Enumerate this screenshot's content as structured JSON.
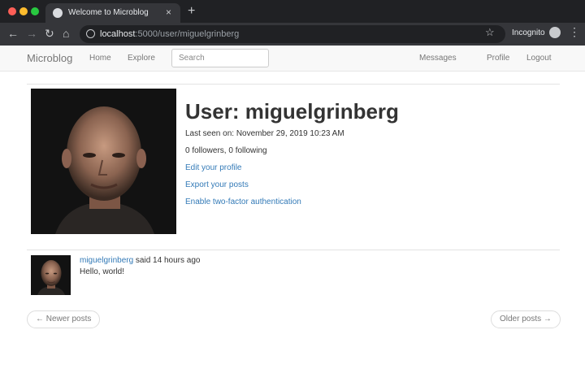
{
  "browser": {
    "tab_title": "Welcome to Microblog",
    "url_host": "localhost",
    "url_path": ":5000/user/miguelgrinberg",
    "profile_label": "Incognito"
  },
  "navbar": {
    "brand": "Microblog",
    "home": "Home",
    "explore": "Explore",
    "search_placeholder": "Search",
    "messages": "Messages",
    "profile": "Profile",
    "logout": "Logout"
  },
  "user": {
    "heading": "User: miguelgrinberg",
    "last_seen": "Last seen on: November 29, 2019 10:23 AM",
    "follow_counts": "0 followers, 0 following",
    "links": {
      "edit_profile": "Edit your profile",
      "export_posts": "Export your posts",
      "enable_2fa": "Enable two-factor authentication"
    }
  },
  "posts": [
    {
      "author": "miguelgrinberg",
      "meta": " said 14 hours ago",
      "body": "Hello, world!"
    }
  ],
  "pagination": {
    "newer": "← Newer posts",
    "older": "Older posts →"
  },
  "icons": {
    "favicon": "globe-icon",
    "back": "arrow-left-icon",
    "forward": "arrow-right-icon",
    "reload": "reload-icon",
    "home": "home-icon",
    "info": "info-icon",
    "bookmark": "star-icon",
    "incognito": "incognito-icon",
    "menu": "kebab-menu-icon"
  },
  "colors": {
    "link": "#337ab7",
    "navbar_bg": "#f8f8f8",
    "chrome_bg": "#35363a"
  }
}
